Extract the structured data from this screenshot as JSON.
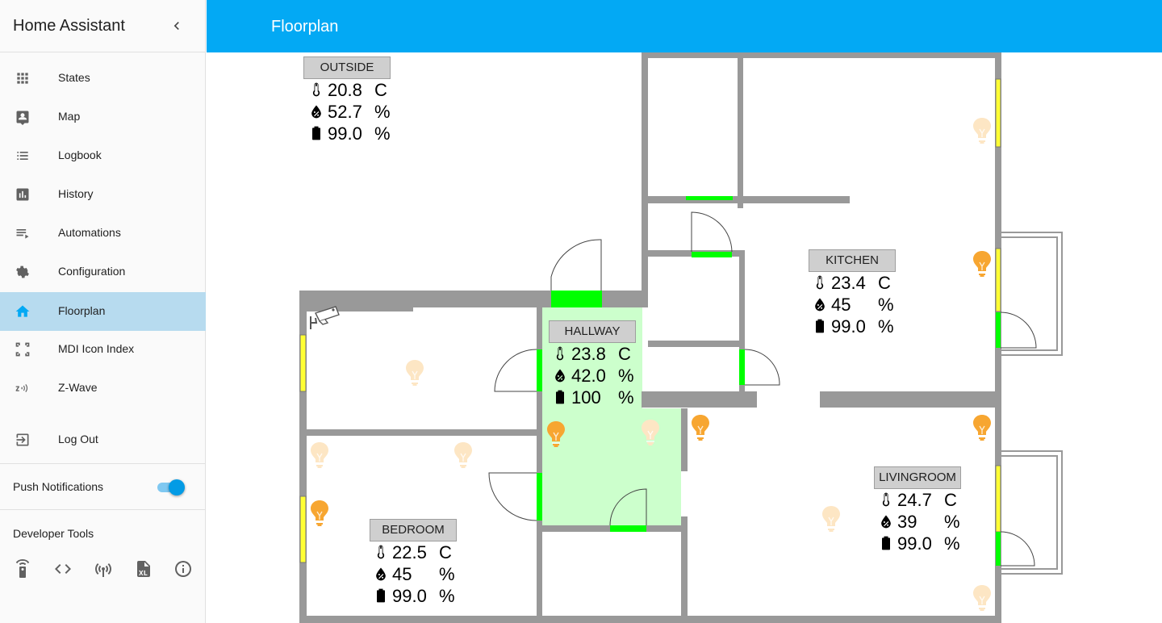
{
  "sidebar": {
    "title": "Home Assistant",
    "collapse_icon": "chevron-left-icon",
    "items": [
      {
        "label": "States",
        "icon": "view-dashboard-icon"
      },
      {
        "label": "Map",
        "icon": "account-box-icon"
      },
      {
        "label": "Logbook",
        "icon": "format-list-bulleted-icon"
      },
      {
        "label": "History",
        "icon": "chart-box-icon"
      },
      {
        "label": "Automations",
        "icon": "playlist-play-icon"
      },
      {
        "label": "Configuration",
        "icon": "settings-icon"
      },
      {
        "label": "Floorplan",
        "icon": "home-icon",
        "active": true
      },
      {
        "label": "MDI Icon Index",
        "icon": "vector-square-icon"
      },
      {
        "label": "Z-Wave",
        "icon": "z-wave-icon"
      },
      {
        "label": "Log Out",
        "icon": "exit-to-app-icon"
      }
    ],
    "push_notifications": {
      "label": "Push Notifications",
      "enabled": true
    },
    "developer_tools": {
      "label": "Developer Tools",
      "tools": [
        "remote-icon",
        "code-tags-icon",
        "radio-tower-icon",
        "file-xml-icon",
        "information-outline-icon"
      ]
    }
  },
  "header": {
    "title": "Floorplan"
  },
  "floorplan": {
    "rooms": {
      "outside": {
        "label": "OUTSIDE",
        "temperature": "20.8",
        "temp_unit": "C",
        "humidity": "52.7",
        "hum_unit": "%",
        "battery": "99.0",
        "bat_unit": "%"
      },
      "kitchen": {
        "label": "KITCHEN",
        "temperature": "23.4",
        "temp_unit": "C",
        "humidity": "45",
        "hum_unit": "%",
        "battery": "99.0",
        "bat_unit": "%"
      },
      "hallway": {
        "label": "HALLWAY",
        "temperature": "23.8",
        "temp_unit": "C",
        "humidity": "42.0",
        "hum_unit": "%",
        "battery": "100",
        "bat_unit": "%"
      },
      "bedroom": {
        "label": "BEDROOM",
        "temperature": "22.5",
        "temp_unit": "C",
        "humidity": "45",
        "hum_unit": "%",
        "battery": "99.0",
        "bat_unit": "%"
      },
      "livingroom": {
        "label": "LIVINGROOM",
        "temperature": "24.7",
        "temp_unit": "C",
        "humidity": "39",
        "hum_unit": "%",
        "battery": "99.0",
        "bat_unit": "%"
      }
    },
    "colors": {
      "wall": "#999999",
      "door_open": "#00ff00",
      "window": "#ffff33",
      "motion_active": "#ccffcc",
      "light_on": "#f7a631",
      "light_off": "#fde6c4"
    },
    "lights": [
      {
        "name": "kitchen-top-light",
        "on": false
      },
      {
        "name": "kitchen-light",
        "on": true
      },
      {
        "name": "bedroom-top-light",
        "on": false
      },
      {
        "name": "hallway-light",
        "on": true
      },
      {
        "name": "hallway-right-light",
        "on": false
      },
      {
        "name": "bedroom-left-light",
        "on": false
      },
      {
        "name": "bedroom-middle-light",
        "on": false
      },
      {
        "name": "bedroom-window-light",
        "on": true
      },
      {
        "name": "livingroom-left-light",
        "on": true
      },
      {
        "name": "livingroom-right-light",
        "on": true
      },
      {
        "name": "livingroom-center-light",
        "on": false
      },
      {
        "name": "livingroom-bottom-light",
        "on": false
      }
    ],
    "camera": {
      "icon": "cctv-camera-icon"
    }
  }
}
